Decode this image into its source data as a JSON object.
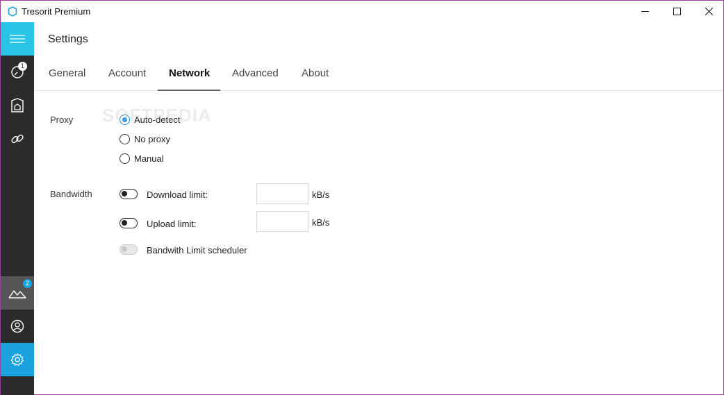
{
  "window": {
    "title": "Tresorit Premium",
    "icons": {
      "logo": "tresorit-logo-icon",
      "minimize": "minimize-icon",
      "maximize": "maximize-icon",
      "close": "close-icon"
    }
  },
  "sidebar": {
    "items": [
      {
        "id": "menu",
        "icon": "hamburger-menu-icon"
      },
      {
        "id": "activity",
        "icon": "activity-clock-icon",
        "badge": "1"
      },
      {
        "id": "tresors",
        "icon": "tresor-box-icon"
      },
      {
        "id": "links",
        "icon": "link-icon"
      },
      {
        "id": "photos",
        "icon": "mountains-icon",
        "badge": "2"
      },
      {
        "id": "account",
        "icon": "user-icon"
      },
      {
        "id": "settings",
        "icon": "gear-icon",
        "active": true
      }
    ],
    "colors": {
      "background": "#2b2b2b",
      "menu": "#29c4e6",
      "active": "#1ba3e0",
      "highlight": "#555555"
    }
  },
  "header": {
    "title": "Settings",
    "tabs": [
      {
        "label": "General"
      },
      {
        "label": "Account"
      },
      {
        "label": "Network",
        "active": true
      },
      {
        "label": "Advanced"
      },
      {
        "label": "About"
      }
    ]
  },
  "proxy": {
    "label": "Proxy",
    "options": [
      {
        "label": "Auto-detect",
        "checked": true
      },
      {
        "label": "No proxy",
        "checked": false
      },
      {
        "label": "Manual",
        "checked": false
      }
    ]
  },
  "bandwidth": {
    "label": "Bandwidth",
    "download": {
      "label": "Download limit:",
      "enabled": false,
      "value": "",
      "unit": "kB/s"
    },
    "upload": {
      "label": "Upload limit:",
      "enabled": false,
      "value": "",
      "unit": "kB/s"
    },
    "scheduler": {
      "label": "Bandwith Limit scheduler",
      "enabled": false,
      "disabled": true
    }
  },
  "watermark": "SOFTPEDIA",
  "accent_color": "#1a8fd6"
}
